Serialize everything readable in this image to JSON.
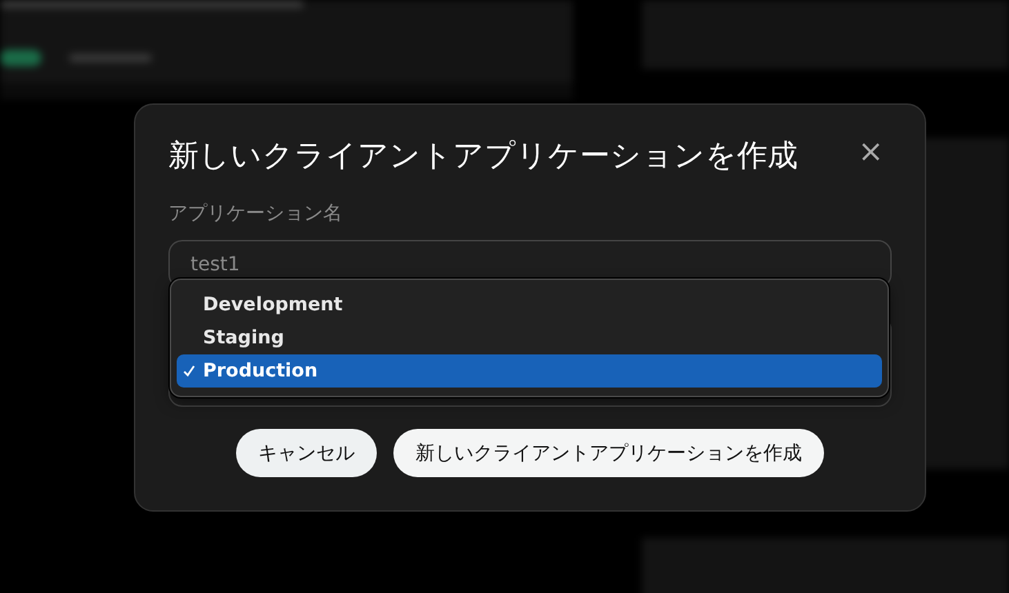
{
  "dialog": {
    "title": "新しいクライアントアプリケーションを作成",
    "close_label": "×",
    "name_field": {
      "label": "アプリケーション名",
      "value": "test1"
    },
    "environment_select": {
      "expanded": true,
      "options": [
        {
          "label": "Development",
          "selected": false
        },
        {
          "label": "Staging",
          "selected": false
        },
        {
          "label": "Production",
          "selected": true
        }
      ]
    },
    "buttons": [
      {
        "label": "キャンセル",
        "kind": "secondary"
      },
      {
        "label": "新しいクライアントアプリケーションを作成",
        "kind": "primary"
      }
    ]
  }
}
